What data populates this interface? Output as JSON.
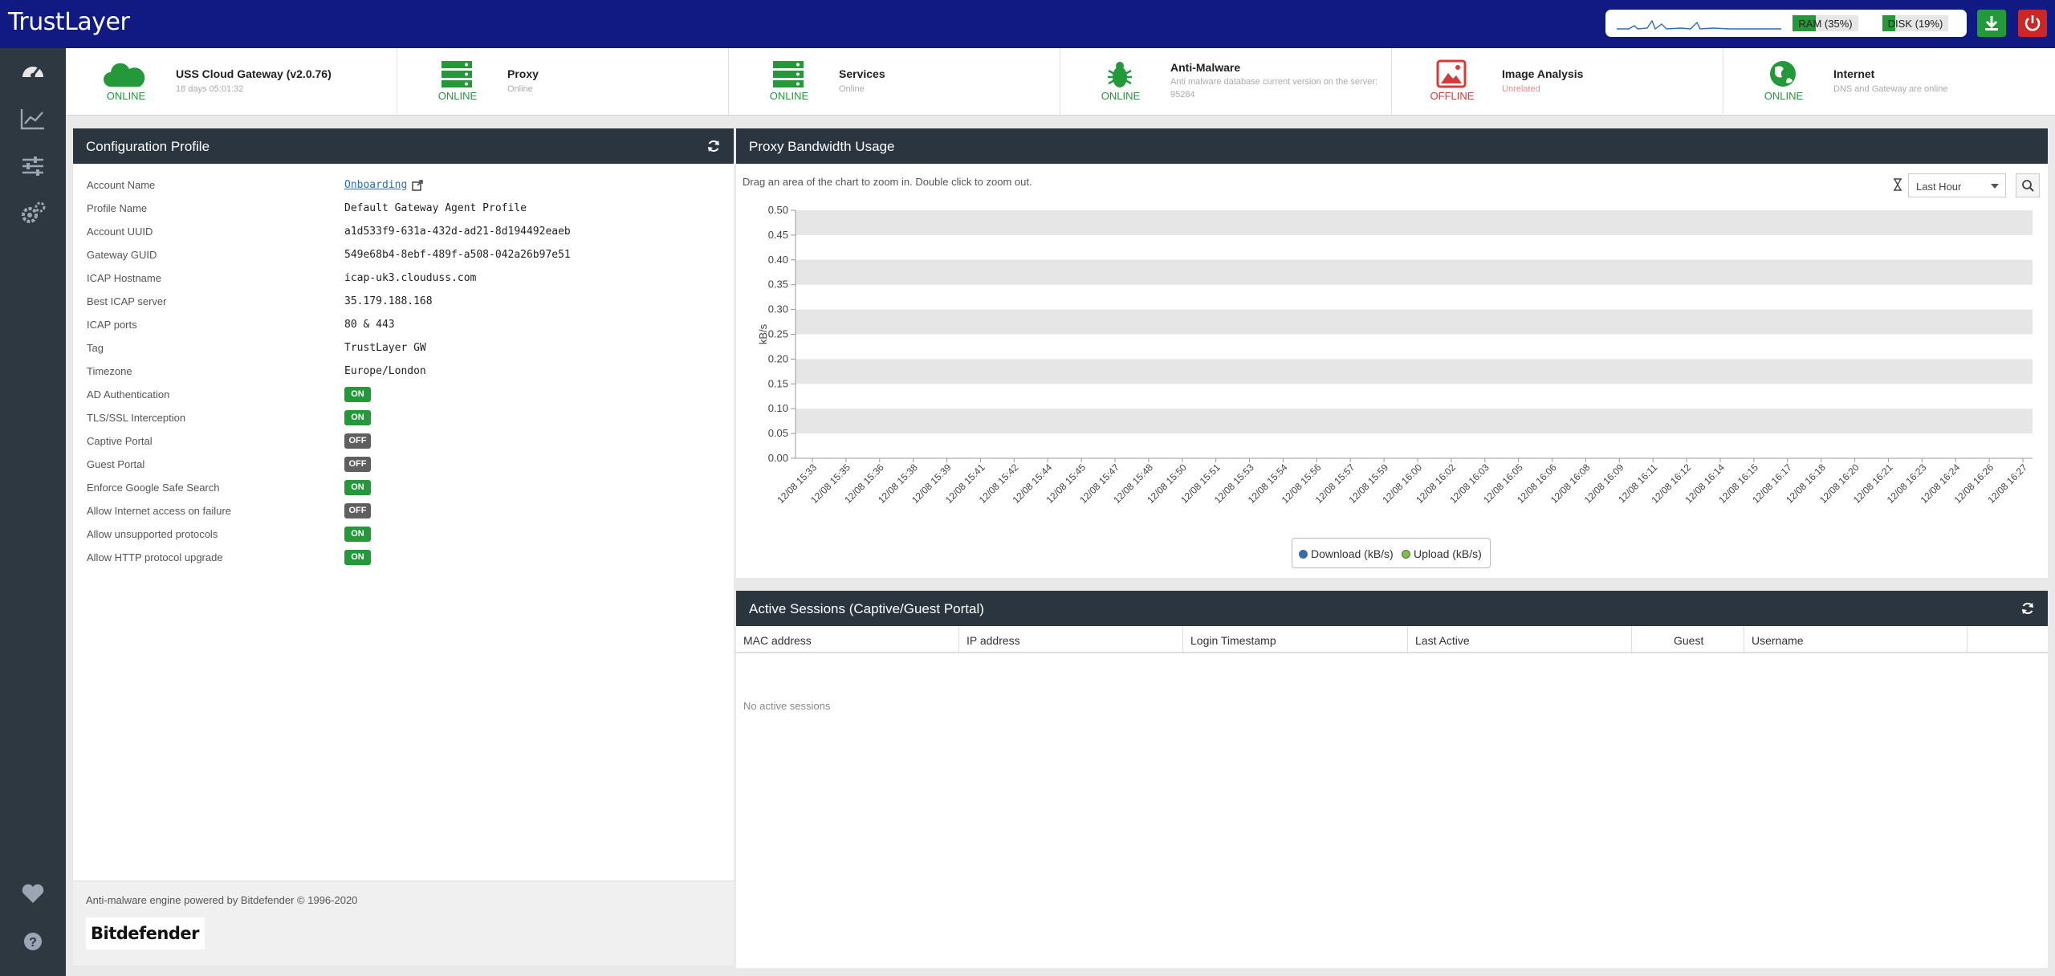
{
  "app": {
    "brand": "TrustLayer",
    "ram_label": "RAM (35%)",
    "ram_pct": 35,
    "disk_label": "DISK (19%)",
    "disk_pct": 19
  },
  "status": [
    {
      "title": "USS Cloud Gateway (v2.0.76)",
      "sub": "18 days 05:01:32",
      "state": "ONLINE",
      "icon": "cloud-icon"
    },
    {
      "title": "Proxy",
      "sub": "Online",
      "state": "ONLINE",
      "icon": "server-icon"
    },
    {
      "title": "Services",
      "sub": "Online",
      "state": "ONLINE",
      "icon": "server-icon"
    },
    {
      "title": "Anti-Malware",
      "sub": "Anti malware database current version on the server: 95284",
      "state": "ONLINE",
      "icon": "bug-icon"
    },
    {
      "title": "Image Analysis",
      "sub": "Unrelated",
      "state": "OFFLINE",
      "icon": "image-icon"
    },
    {
      "title": "Internet",
      "sub": "DNS and Gateway are online",
      "state": "ONLINE",
      "icon": "globe-icon"
    }
  ],
  "config": {
    "title": "Configuration Profile",
    "rows": [
      {
        "key": "Account Name",
        "value": "Onboarding"
      },
      {
        "key": "Profile Name",
        "value": "Default Gateway Agent Profile"
      },
      {
        "key": "Account UUID",
        "value": "a1d533f9-631a-432d-ad21-8d194492eaeb"
      },
      {
        "key": "Gateway GUID",
        "value": "549e68b4-8ebf-489f-a508-042a26b97e51"
      },
      {
        "key": "ICAP Hostname",
        "value": "icap-uk3.clouduss.com"
      },
      {
        "key": "Best ICAP server",
        "value": "35.179.188.168"
      },
      {
        "key": "ICAP ports",
        "value": "80 & 443"
      },
      {
        "key": "Tag",
        "value": "TrustLayer GW"
      },
      {
        "key": "Timezone",
        "value": "Europe/London"
      }
    ],
    "toggles": [
      {
        "key": "AD Authentication",
        "value": "ON"
      },
      {
        "key": "TLS/SSL Interception",
        "value": "ON"
      },
      {
        "key": "Captive Portal",
        "value": "OFF"
      },
      {
        "key": "Guest Portal",
        "value": "OFF"
      },
      {
        "key": "Enforce Google Safe Search",
        "value": "ON"
      },
      {
        "key": "Allow Internet access on failure",
        "value": "OFF"
      },
      {
        "key": "Allow unsupported protocols",
        "value": "ON"
      },
      {
        "key": "Allow HTTP protocol upgrade",
        "value": "ON"
      }
    ],
    "footer": "Anti-malware engine powered by Bitdefender © 1996-2020",
    "logo": "Bitdefender"
  },
  "bandwidth": {
    "title": "Proxy Bandwidth Usage",
    "hint": "Drag an area of the chart to zoom in. Double click to zoom out.",
    "range": "Last Hour"
  },
  "chart_data": {
    "type": "line",
    "ylabel": "kB/s",
    "ylim": [
      0,
      0.5
    ],
    "yticks": [
      "0.00",
      "0.05",
      "0.10",
      "0.15",
      "0.20",
      "0.25",
      "0.30",
      "0.35",
      "0.40",
      "0.45",
      "0.50"
    ],
    "x": [
      "12/08 15:33",
      "12/08 15:35",
      "12/08 15:36",
      "12/08 15:38",
      "12/08 15:39",
      "12/08 15:41",
      "12/08 15:42",
      "12/08 15:44",
      "12/08 15:45",
      "12/08 15:47",
      "12/08 15:48",
      "12/08 15:50",
      "12/08 15:51",
      "12/08 15:53",
      "12/08 15:54",
      "12/08 15:56",
      "12/08 15:57",
      "12/08 15:59",
      "12/08 16:00",
      "12/08 16:02",
      "12/08 16:03",
      "12/08 16:05",
      "12/08 16:06",
      "12/08 16:08",
      "12/08 16:09",
      "12/08 16:11",
      "12/08 16:12",
      "12/08 16:14",
      "12/08 16:15",
      "12/08 16:17",
      "12/08 16:18",
      "12/08 16:20",
      "12/08 16:21",
      "12/08 16:23",
      "12/08 16:24",
      "12/08 16:26",
      "12/08 16:27"
    ],
    "series": [
      {
        "name": "Download (kB/s)",
        "color": "#2c6fb8",
        "values": []
      },
      {
        "name": "Upload (kB/s)",
        "color": "#7bc043",
        "values": []
      }
    ],
    "legend": "bottom-center",
    "grid": true
  },
  "sessions": {
    "title": "Active Sessions (Captive/Guest Portal)",
    "columns": [
      "MAC address",
      "IP address",
      "Login Timestamp",
      "Last Active",
      "Guest",
      "Username"
    ],
    "empty": "No active sessions"
  }
}
